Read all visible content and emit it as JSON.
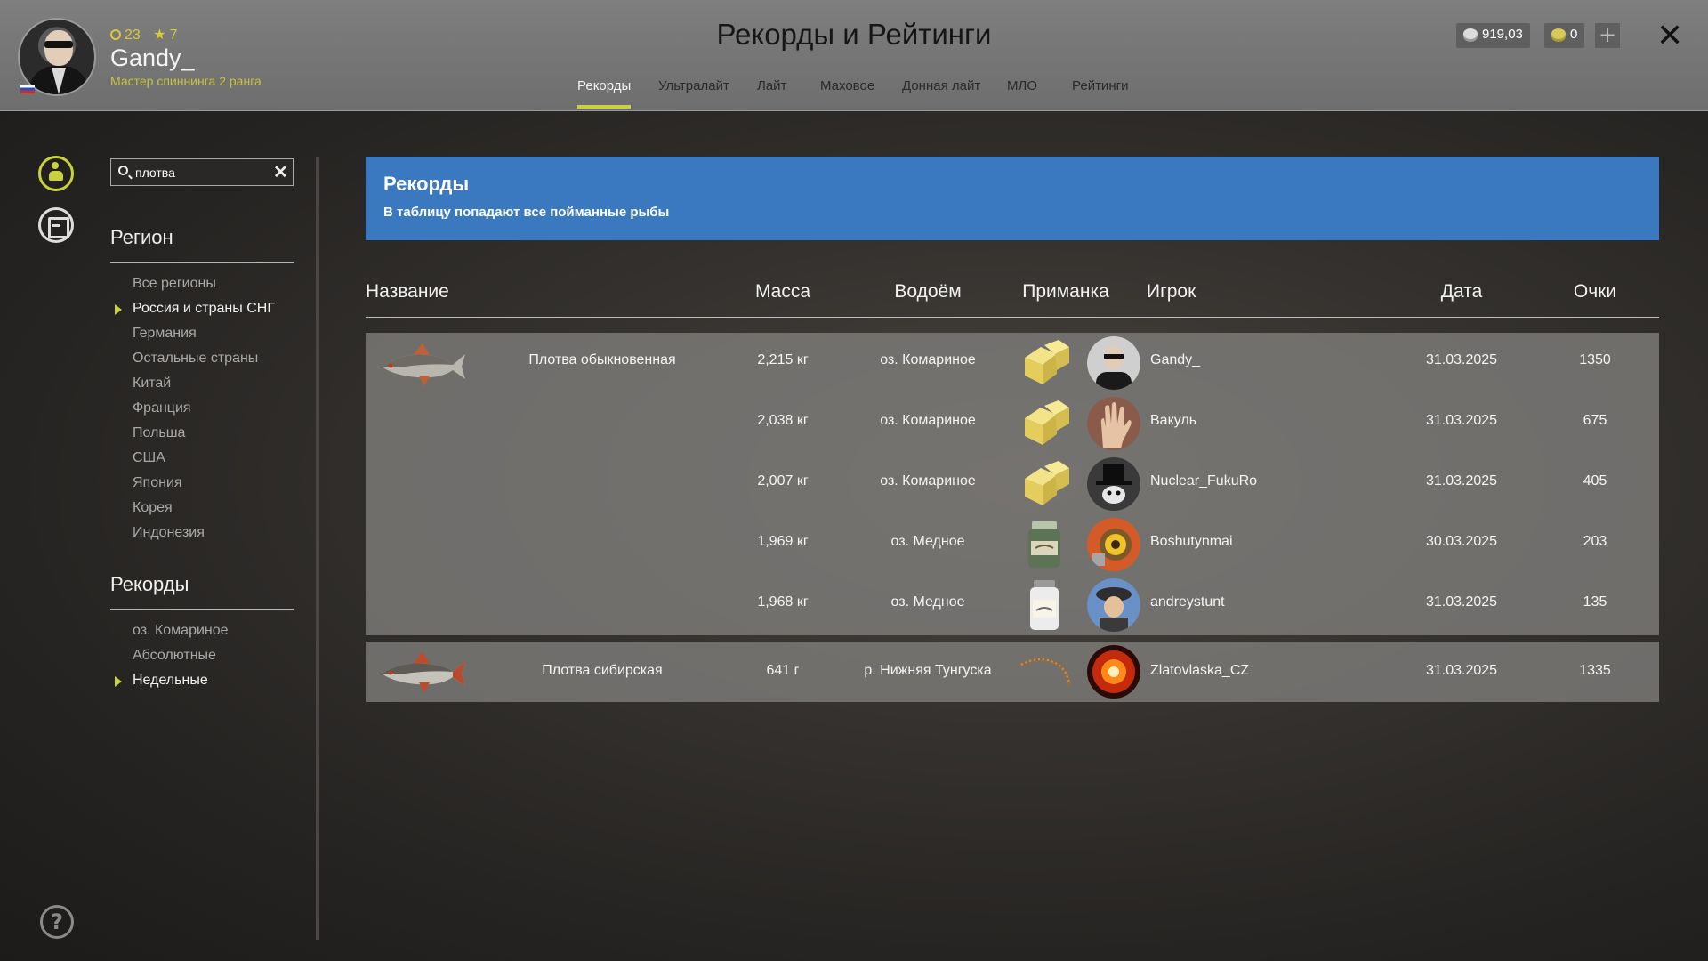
{
  "header": {
    "title": "Рекорды и Рейтинги",
    "player": {
      "name": "Gandy_",
      "level": "23",
      "stars": "7",
      "rank": "Мастер спиннинга 2 ранга"
    },
    "tabs": [
      {
        "label": "Рекорды",
        "active": true
      },
      {
        "label": "Ультралайт"
      },
      {
        "label": "Лайт"
      },
      {
        "label": "Маховое"
      },
      {
        "label": "Донная лайт"
      },
      {
        "label": "МЛО"
      },
      {
        "label": "Рейтинги"
      }
    ],
    "silver": "919,03",
    "gold": "0",
    "plus_label": "+",
    "close_label": "✕"
  },
  "sidebar": {
    "help_label": "?"
  },
  "filters": {
    "search": {
      "value": "плотва",
      "clear_label": "✕"
    },
    "region_title": "Регион",
    "regions": [
      {
        "label": "Все регионы"
      },
      {
        "label": "Россия и страны СНГ",
        "active": true
      },
      {
        "label": "Германия"
      },
      {
        "label": "Остальные страны"
      },
      {
        "label": "Китай"
      },
      {
        "label": "Франция"
      },
      {
        "label": "Польша"
      },
      {
        "label": "США"
      },
      {
        "label": "Япония"
      },
      {
        "label": "Корея"
      },
      {
        "label": "Индонезия"
      }
    ],
    "records_title": "Рекорды",
    "records": [
      {
        "label": "оз. Комариное"
      },
      {
        "label": "Абсолютные"
      },
      {
        "label": "Недельные",
        "active": true
      }
    ]
  },
  "banner": {
    "title": "Рекорды",
    "subtitle": "В таблицу попадают все пойманные рыбы"
  },
  "table": {
    "columns": {
      "name": "Название",
      "mass": "Масса",
      "water": "Водоём",
      "bait": "Приманка",
      "player": "Игрок",
      "date": "Дата",
      "points": "Очки"
    },
    "groups": [
      {
        "fish": "Плотва обыкновенная",
        "fish_icon": "roach-fish-icon",
        "rows": [
          {
            "mass": "2,215 кг",
            "water": "оз. Комариное",
            "bait": "bread-cube-bait-icon",
            "player": "Gandy_",
            "avatar": "man-sunglasses-avatar",
            "date": "31.03.2025",
            "points": "1350"
          },
          {
            "mass": "2,038 кг",
            "water": "оз. Комариное",
            "bait": "bread-cube-bait-icon",
            "player": "Вакуль",
            "avatar": "hand-avatar",
            "date": "31.03.2025",
            "points": "675"
          },
          {
            "mass": "2,007 кг",
            "water": "оз. Комариное",
            "bait": "bread-cube-bait-icon",
            "player": "Nuclear_FukuRo",
            "avatar": "top-hat-avatar",
            "date": "31.03.2025",
            "points": "405"
          },
          {
            "mass": "1,969 кг",
            "water": "оз. Медное",
            "bait": "green-jar-bait-icon",
            "player": "Boshutynmai",
            "avatar": "robot-avatar",
            "date": "30.03.2025",
            "points": "203"
          },
          {
            "mass": "1,968 кг",
            "water": "оз. Медное",
            "bait": "white-jar-bait-icon",
            "player": "andreystunt",
            "avatar": "detective-avatar",
            "date": "31.03.2025",
            "points": "135"
          }
        ]
      },
      {
        "fish": "Плотва сибирская",
        "fish_icon": "siberian-roach-fish-icon",
        "rows": [
          {
            "mass": "641 г",
            "water": "р. Нижняя Тунгуска",
            "bait": "worm-bait-icon",
            "player": "Zlatovlaska_CZ",
            "avatar": "fire-orb-avatar",
            "date": "31.03.2025",
            "points": "1335"
          }
        ]
      }
    ]
  },
  "colors": {
    "accent": "#c8d23a",
    "banner": "#3a78c0",
    "header": "#777777"
  }
}
